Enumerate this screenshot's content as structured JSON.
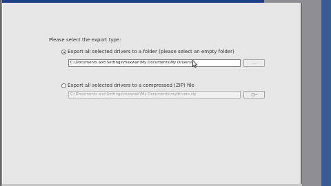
{
  "prompt": "Please select the export type:",
  "options": [
    {
      "label": "Export all selected drivers to a folder (please select an empty folder)",
      "checked": true,
      "path": "C:\\Documents and Settings\\maxwan\\My Documents\\My Drivers\\",
      "browse_label": "..."
    },
    {
      "label": "Export all selected drivers to a compressed (ZIP) file",
      "checked": false,
      "path": "C:\\Documents and Settings\\maxwan\\My Documents\\mydrivers.zip",
      "browse_label": "..."
    }
  ],
  "icons": {
    "cursor": "mouse-pointer-icon",
    "browse": "folder-browse-icon"
  },
  "colors": {
    "dialog_bg": "#e6e6e6",
    "title_blue": "#1c3f86",
    "side_blue": "#3b5b95",
    "background": "#8e8e93"
  }
}
